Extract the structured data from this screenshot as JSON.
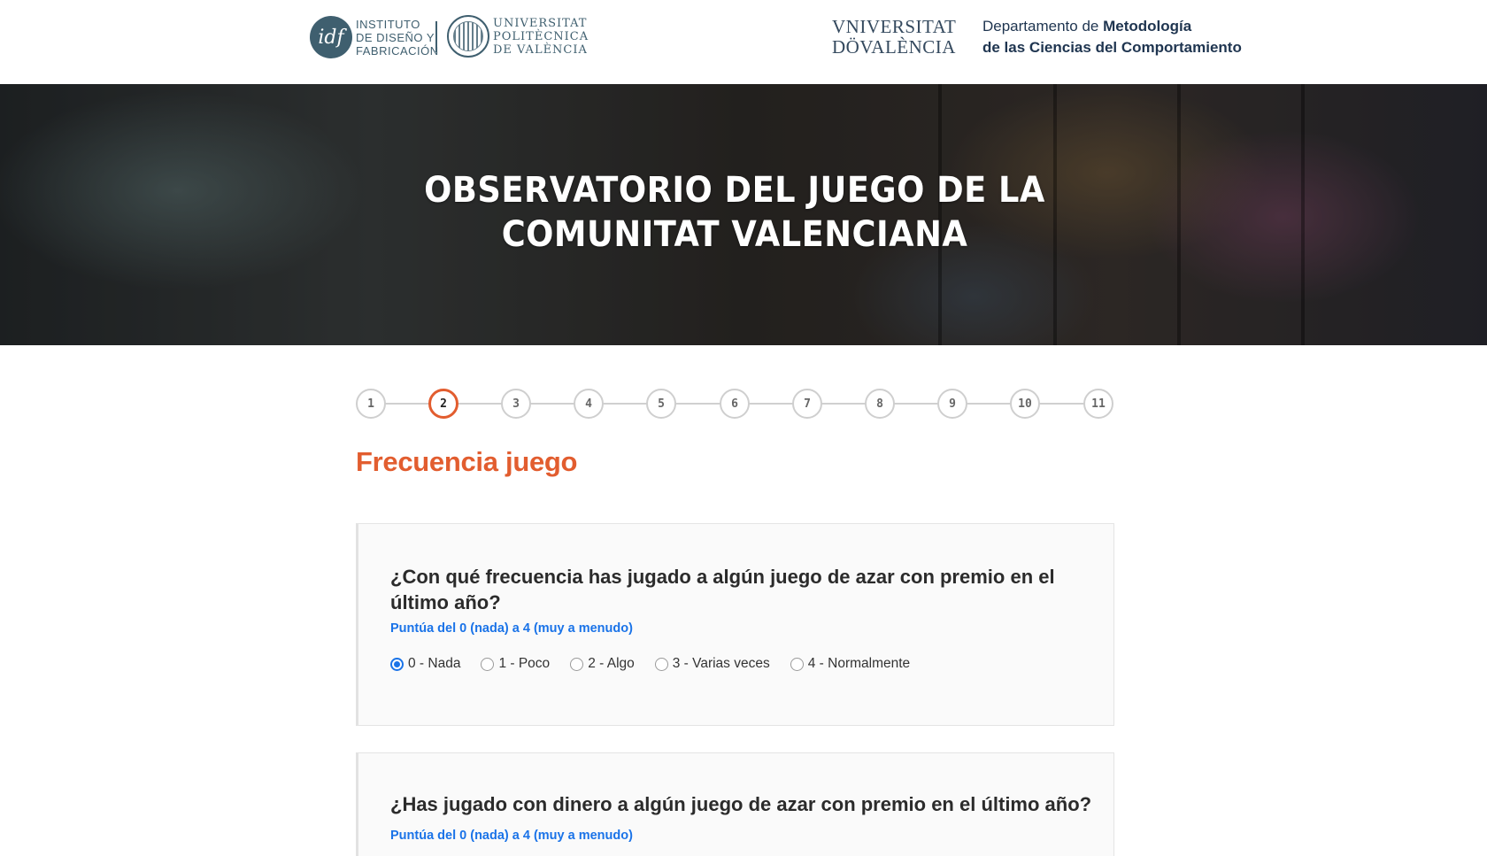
{
  "header": {
    "idf_logo": {
      "mark": "idf",
      "lines": [
        "INSTITUTO",
        "DE DISEÑO Y",
        "FABRICACIÓN"
      ]
    },
    "upv_logo": {
      "lines": [
        "UNIVERSITAT",
        "POLITÈCNICA",
        "DE VALÈNCIA"
      ]
    },
    "uv_logo": {
      "lines": [
        "VNIVERSITAT",
        "DÖVALÈNCIA"
      ]
    },
    "department": {
      "line1_prefix": "Departamento de ",
      "line1_bold": "Metodología",
      "line2": "de las Ciencias del Comportamiento"
    }
  },
  "banner": {
    "title": "OBSERVATORIO DEL JUEGO DE LA COMUNITAT VALENCIANA"
  },
  "stepper": {
    "steps": [
      "1",
      "2",
      "3",
      "4",
      "5",
      "6",
      "7",
      "8",
      "9",
      "10",
      "11"
    ],
    "current": 2
  },
  "section": {
    "title": "Frecuencia juego"
  },
  "questions": [
    {
      "text": "¿Con qué frecuencia has jugado a algún juego de azar con premio en el último año?",
      "hint": "Puntúa del 0 (nada) a 4 (muy a menudo)",
      "options": [
        "0 - Nada",
        "1 - Poco",
        "2 - Algo",
        "3 - Varias veces",
        "4 - Normalmente"
      ],
      "selected": "0 - Nada"
    },
    {
      "text": "¿Has jugado con dinero a algún juego de azar con premio en el último año?",
      "hint": "Puntúa del 0 (nada) a 4 (muy a menudo)"
    }
  ],
  "colors": {
    "accent": "#e25d2f",
    "link": "#1a73e8",
    "logo": "#3f5f6f"
  }
}
